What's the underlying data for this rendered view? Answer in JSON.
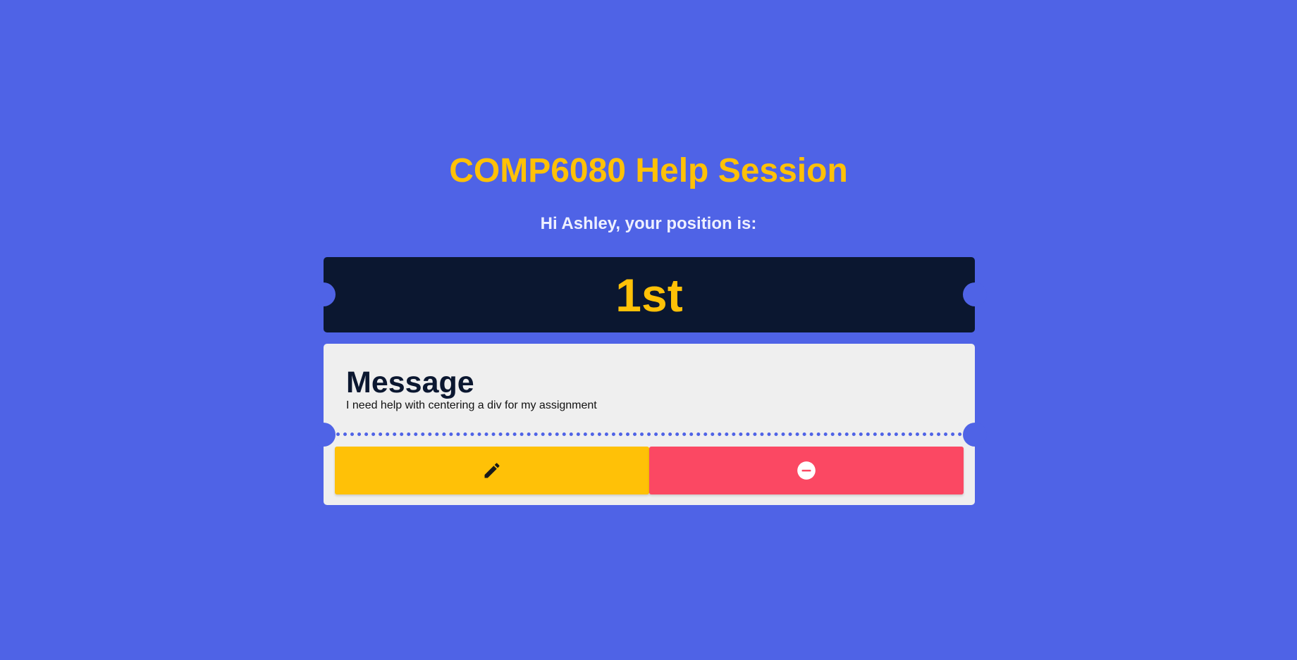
{
  "header": {
    "title": "COMP6080 Help Session",
    "greeting": "Hi Ashley, your position is:"
  },
  "ticket": {
    "position": "1st"
  },
  "message": {
    "heading": "Message",
    "text": "I need help with centering a div for my assignment"
  },
  "actions": {
    "edit": {
      "icon": "pencil-icon",
      "color": "#ffc107"
    },
    "leave": {
      "icon": "minus-circle-icon",
      "color": "#fb4863"
    }
  },
  "colors": {
    "background": "#4f63e6",
    "accent": "#ffc107",
    "ticket_dark": "#0b1730",
    "card": "#efefef"
  }
}
